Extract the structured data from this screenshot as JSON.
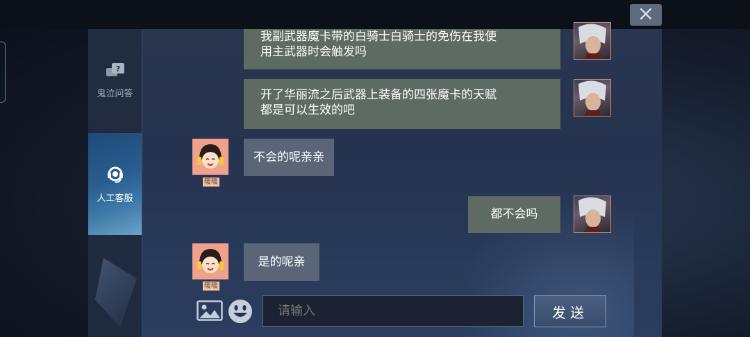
{
  "window": {
    "close_label": "✕"
  },
  "sidebar": {
    "items": [
      {
        "label": "鬼泣问答",
        "icon": "faq-chat-icon"
      },
      {
        "label": "人工客服",
        "icon": "customer-service-headset-icon",
        "active": true
      }
    ]
  },
  "messages": [
    {
      "from": "user",
      "text_line1": "我副武器魔卡带的白骑士白骑士的免伤在我使",
      "text_line2": "用主武器时会触发吗"
    },
    {
      "from": "user",
      "text_line1": "开了华丽流之后武器上装备的四张魔卡的天赋",
      "text_line2": "都是可以生效的吧"
    },
    {
      "from": "agent",
      "name": "暖暖",
      "text": "不会的呢亲亲"
    },
    {
      "from": "user",
      "text": "都不会吗"
    },
    {
      "from": "agent",
      "name": "暖暖",
      "text": "是的呢亲"
    }
  ],
  "input": {
    "placeholder": "请输入",
    "image_icon": "image-icon",
    "emoji_icon": "emoji-icon"
  },
  "send_button": {
    "label": "发送"
  },
  "colors": {
    "user_bubble": "#5d6b62",
    "agent_bubble": "#5a6678",
    "accent": "#3d79a8"
  }
}
